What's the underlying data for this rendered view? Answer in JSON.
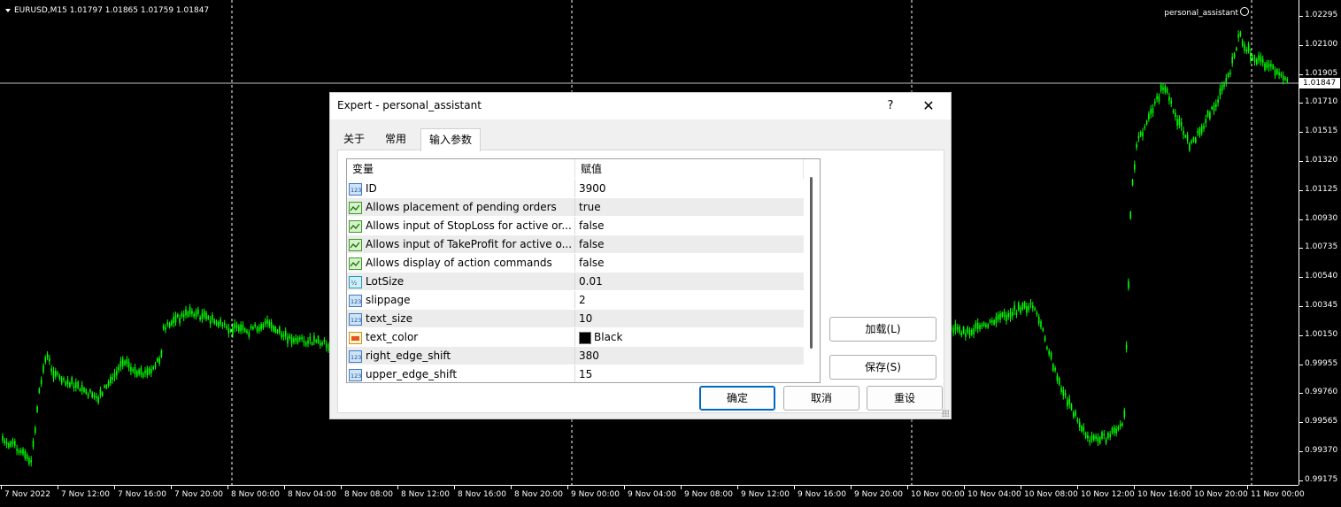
{
  "chart": {
    "symbol_info": "EURUSD,M15  1.01797 1.01865 1.01759 1.01847",
    "ea_label": "personal_assistant",
    "current_price": "1.01847",
    "price_ticks": [
      "1.02295",
      "1.02100",
      "1.01905",
      "1.01710",
      "1.01515",
      "1.01320",
      "1.01125",
      "1.00930",
      "1.00735",
      "1.00540",
      "1.00345",
      "1.00150",
      "0.99955",
      "0.99760",
      "0.99565",
      "0.99370",
      "0.99175"
    ],
    "time_ticks": [
      "7 Nov 2022",
      "7 Nov 12:00",
      "7 Nov 16:00",
      "7 Nov 20:00",
      "8 Nov 00:00",
      "8 Nov 04:00",
      "8 Nov 08:00",
      "8 Nov 12:00",
      "8 Nov 16:00",
      "8 Nov 20:00",
      "9 Nov 00:00",
      "9 Nov 04:00",
      "9 Nov 08:00",
      "9 Nov 12:00",
      "9 Nov 16:00",
      "9 Nov 20:00",
      "10 Nov 00:00",
      "10 Nov 04:00",
      "10 Nov 08:00",
      "10 Nov 12:00",
      "10 Nov 16:00",
      "10 Nov 20:00",
      "11 Nov 00:00"
    ],
    "colors": {
      "background": "#000000",
      "candles": "#00ff00",
      "grid": "#ffffff",
      "axis_text": "#ffffff"
    }
  },
  "dialog": {
    "title": "Expert - personal_assistant",
    "help_label": "?",
    "close_label": "✕",
    "tabs": [
      {
        "label": "关于",
        "active": false
      },
      {
        "label": "常用",
        "active": false
      },
      {
        "label": "输入参数",
        "active": true
      }
    ],
    "table": {
      "headers": {
        "variable": "变量",
        "value": "赋值"
      },
      "rows": [
        {
          "icon": "integer-icon",
          "name": "ID",
          "value": "3900"
        },
        {
          "icon": "boolean-icon",
          "name": "Allows placement of pending orders",
          "value": "true"
        },
        {
          "icon": "boolean-icon",
          "name": "Allows input of StopLoss for active or...",
          "value": "false"
        },
        {
          "icon": "boolean-icon",
          "name": "Allows input of TakeProfit for active o...",
          "value": "false"
        },
        {
          "icon": "boolean-icon",
          "name": "Allows display of action commands",
          "value": "false"
        },
        {
          "icon": "double-icon",
          "name": "LotSize",
          "value": "0.01"
        },
        {
          "icon": "integer-icon",
          "name": "slippage",
          "value": "2"
        },
        {
          "icon": "integer-icon",
          "name": "text_size",
          "value": "10"
        },
        {
          "icon": "color-icon",
          "name": "text_color",
          "value": "Black",
          "swatch": "#000000"
        },
        {
          "icon": "integer-icon",
          "name": "right_edge_shift",
          "value": "380"
        },
        {
          "icon": "integer-icon",
          "name": "upper_edge_shift",
          "value": "15"
        }
      ]
    },
    "buttons": {
      "load": "加载(L)",
      "save": "保存(S)",
      "ok": "确定",
      "cancel": "取消",
      "reset": "重设"
    }
  }
}
